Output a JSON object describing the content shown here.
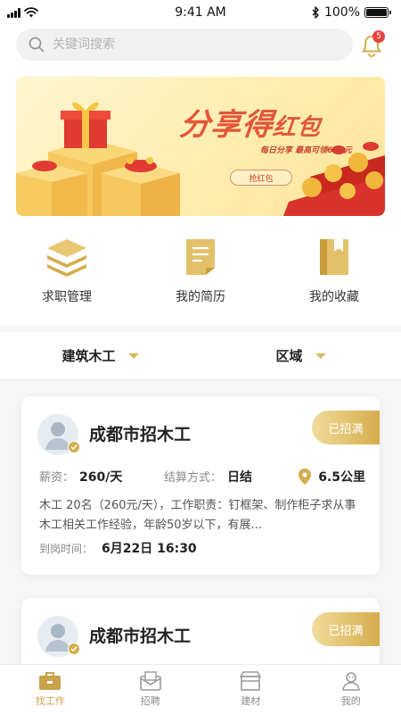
{
  "status_bar": {
    "time": "9:41 AM",
    "battery": "100%",
    "battery_level": 1.0
  },
  "search": {
    "placeholder": "关键词搜索",
    "icon": "search-icon"
  },
  "notifications": {
    "icon": "bell-icon",
    "badge": "5"
  },
  "banner": {
    "title_main": "分享得",
    "title_accent": "红包",
    "subtitle": "每日分享 最高可领666元",
    "button": "抢红包"
  },
  "quick_entries": [
    {
      "label": "求职管理",
      "icon": "stack-icon"
    },
    {
      "label": "我的简历",
      "icon": "document-icon"
    },
    {
      "label": "我的收藏",
      "icon": "bookmark-icon"
    }
  ],
  "filters": [
    {
      "label": "建筑木工"
    },
    {
      "label": "区域"
    }
  ],
  "jobs": [
    {
      "title": "成都市招木工",
      "tag": "已招满",
      "salary_label": "薪资：",
      "salary": "260/天",
      "settle_label": "结算方式：",
      "settle": "日结",
      "distance": "6.5公里",
      "description": "木工 20名（260元/天），工作职责：钉框架、制作柜子求从事木工相关工作经验，年龄50岁以下，有展...",
      "time_label": "到岗时间：",
      "time": "6月22日  16:30"
    },
    {
      "title": "成都市招木工",
      "tag": "已招满"
    }
  ],
  "tabs": [
    {
      "label": "找工作",
      "icon": "briefcase-icon",
      "active": true
    },
    {
      "label": "招聘",
      "icon": "mail-icon",
      "active": false
    },
    {
      "label": "建材",
      "icon": "store-icon",
      "active": false
    },
    {
      "label": "我的",
      "icon": "user-icon",
      "active": false
    }
  ],
  "colors": {
    "accent": "#d4ad4d",
    "badge": "#e94343",
    "banner_title": "#e2563a"
  }
}
